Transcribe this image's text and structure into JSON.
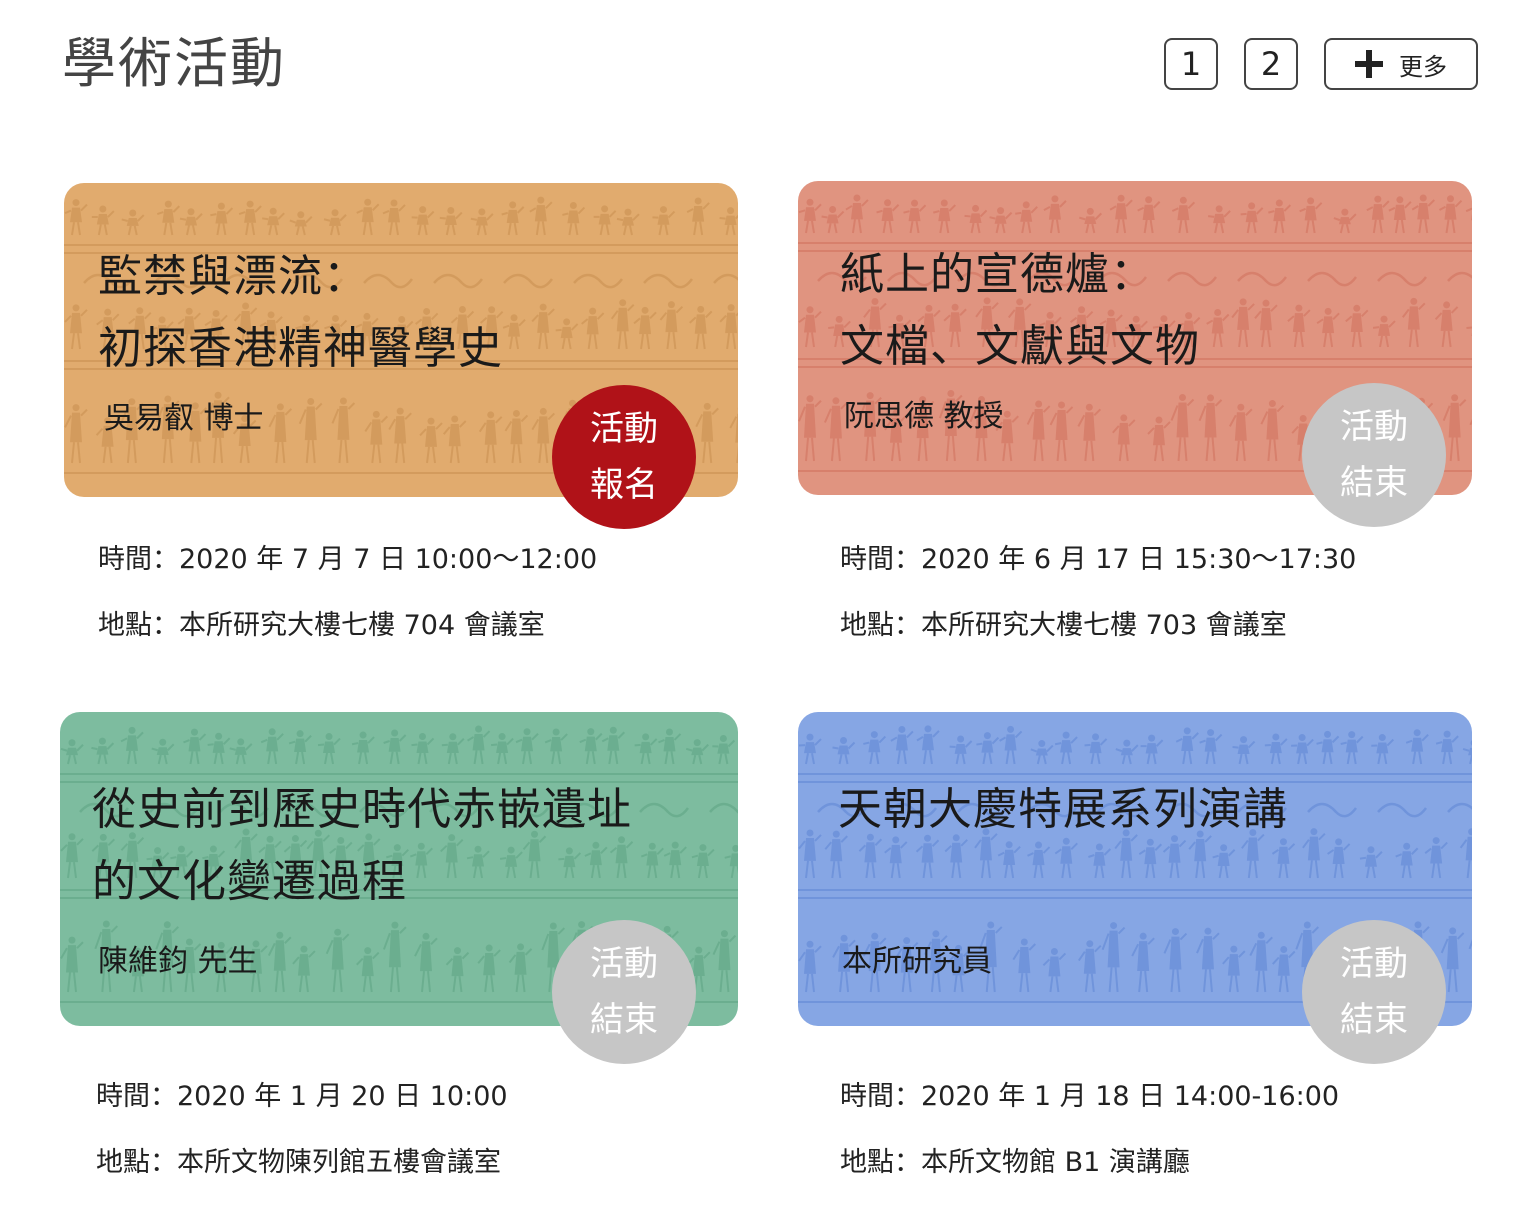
{
  "header": {
    "title": "學術活動",
    "pages": [
      "1",
      "2"
    ],
    "more_label": "更多",
    "more_icon": "plus-icon"
  },
  "cards": [
    {
      "title": "監禁與漂流：\n初探香港精神醫學史",
      "speaker": "吳易叡 博士",
      "status": [
        "活動",
        "報名"
      ],
      "status_color": "#b01218",
      "card_color": "#e1ab6e",
      "pattern_color": "#c98f50",
      "time": "時間：2020 年 7 月 7 日 10:00～12:00",
      "place": "地點：本所研究大樓七樓 704 會議室"
    },
    {
      "title": "紙上的宣德爐：\n文檔、文獻與文物",
      "speaker": "阮思德 教授",
      "status": [
        "活動",
        "結束"
      ],
      "status_color": "#c6c6c6",
      "card_color": "#e09480",
      "pattern_color": "#d0705c",
      "time": "時間：2020 年 6 月 17 日 15:30～17:30",
      "place": "地點：本所研究大樓七樓 703 會議室"
    },
    {
      "title": "從史前到歷史時代赤嵌遺址\n的文化變遷過程",
      "speaker": "陳維鈞 先生",
      "status": [
        "活動",
        "結束"
      ],
      "status_color": "#c6c6c6",
      "card_color": "#7dbc9f",
      "pattern_color": "#5ea383",
      "time": "時間：2020 年 1 月 20 日 10:00",
      "place": "地點：本所文物陳列館五樓會議室"
    },
    {
      "title": "天朝大慶特展系列演講",
      "speaker": "本所研究員",
      "status": [
        "活動",
        "結束"
      ],
      "status_color": "#c6c6c6",
      "card_color": "#86a6e4",
      "pattern_color": "#5f86d4",
      "time": "時間：2020 年 1 月 18 日 14:00-16:00",
      "place": "地點：本所文物館 B1 演講廳"
    }
  ]
}
